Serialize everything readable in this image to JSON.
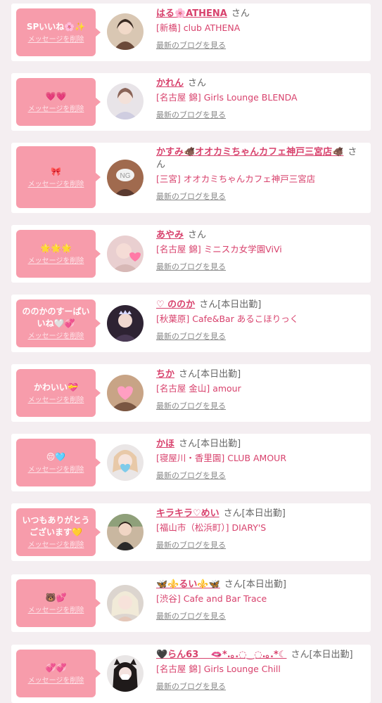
{
  "delete_label": "メッセージを削除",
  "blog_label": "最新のブログを見る",
  "san": "さん",
  "items": [
    {
      "message": "SPいいね🌸✨",
      "name": "はる🌸ATHENA",
      "status": "",
      "shop": "[新橋] club ATHENA"
    },
    {
      "message": "💗💗",
      "name": "かれん",
      "status": "",
      "shop": "[名古屋 錦] Girls Lounge BLENDA"
    },
    {
      "message": "🎀",
      "name": "かすみ🐗オオカミちゃんカフェ神戸三宮店🐗",
      "status": "",
      "shop": "[三宮] オオカミちゃんカフェ神戸三宮店"
    },
    {
      "message": "🌟🌟🌟",
      "name": "あやみ",
      "status": "",
      "shop": "[名古屋 錦] ミニスカ女学園ViVi"
    },
    {
      "message": "ののかのすーぱいいね🤍💞",
      "name": "♡ ののか",
      "status": "[本日出勤]",
      "shop": "[秋葉原] Cafe&Bar あるこほりっく"
    },
    {
      "message": "かわいい💝",
      "name": "ちか",
      "status": "[本日出勤]",
      "shop": "[名古屋 金山] amour"
    },
    {
      "message": "😔🩵",
      "name": "かほ",
      "status": "[本日出勤]",
      "shop": "[寝屋川・香里園] CLUB AMOUR"
    },
    {
      "message": "いつもありがとうございます💛",
      "name": "キラキラ♡めい",
      "status": "[本日出勤]",
      "shop": "[福山市（松浜町）] DIARY'S"
    },
    {
      "message": "🐻💕",
      "name": "🦋⚜️るい⚜️🦋",
      "status": "[本日出勤]",
      "shop": "[渋谷] Cafe and Bar Trace"
    },
    {
      "message": "💞💞",
      "name": "🖤らん63 　🫦*.｡.◌‿◌.｡.*☾",
      "status": "[本日出勤]",
      "shop": "[名古屋 錦] Girls Lounge Chill"
    }
  ]
}
